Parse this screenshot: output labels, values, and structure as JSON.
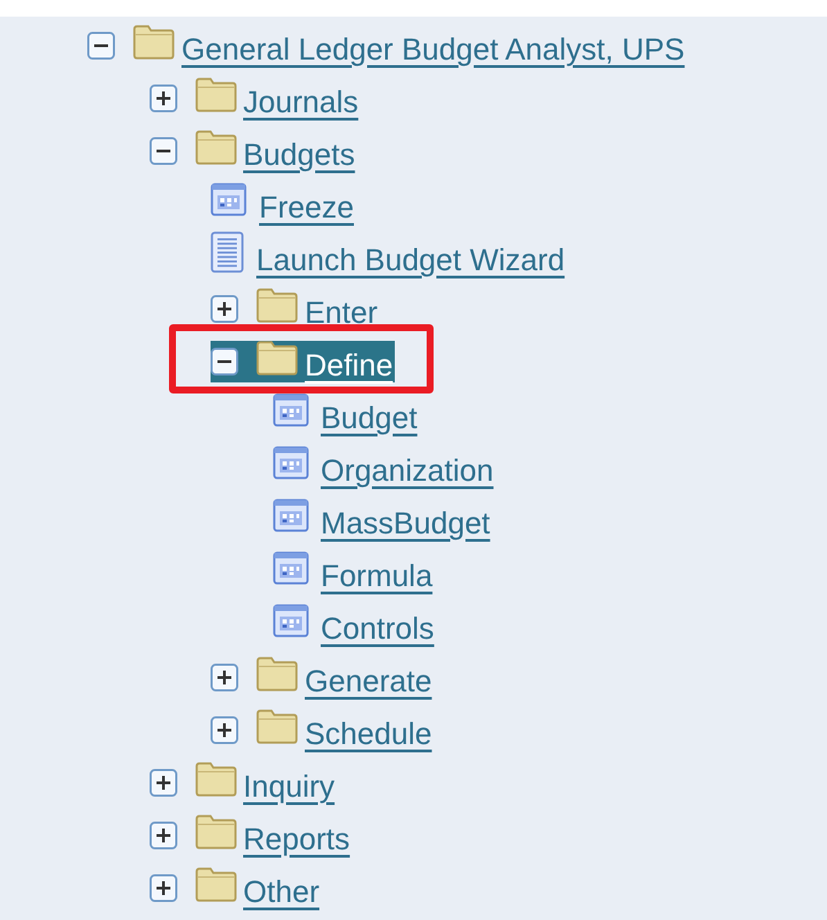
{
  "tree": [
    {
      "kind": "folder",
      "label": "General Ledger Budget Analyst, UPS",
      "expanded": true,
      "selected": false,
      "children": [
        {
          "kind": "folder",
          "label": "Journals",
          "expanded": false,
          "selected": false
        },
        {
          "kind": "folder",
          "label": "Budgets",
          "expanded": true,
          "selected": false,
          "children": [
            {
              "kind": "form",
              "label": "Freeze",
              "selected": false
            },
            {
              "kind": "process",
              "label": "Launch Budget Wizard",
              "selected": false
            },
            {
              "kind": "folder",
              "label": "Enter",
              "expanded": false,
              "selected": false
            },
            {
              "kind": "folder",
              "label": "Define",
              "expanded": true,
              "selected": true,
              "highlighted": true,
              "children": [
                {
                  "kind": "form",
                  "label": "Budget",
                  "selected": false
                },
                {
                  "kind": "form",
                  "label": "Organization",
                  "selected": false
                },
                {
                  "kind": "form",
                  "label": "MassBudget",
                  "selected": false
                },
                {
                  "kind": "form",
                  "label": "Formula",
                  "selected": false
                },
                {
                  "kind": "form",
                  "label": "Controls",
                  "selected": false
                }
              ]
            },
            {
              "kind": "folder",
              "label": "Generate",
              "expanded": false,
              "selected": false
            },
            {
              "kind": "folder",
              "label": "Schedule",
              "expanded": false,
              "selected": false
            }
          ]
        },
        {
          "kind": "folder",
          "label": "Inquiry",
          "expanded": false,
          "selected": false
        },
        {
          "kind": "folder",
          "label": "Reports",
          "expanded": false,
          "selected": false
        },
        {
          "kind": "folder",
          "label": "Other",
          "expanded": false,
          "selected": false
        }
      ]
    }
  ]
}
